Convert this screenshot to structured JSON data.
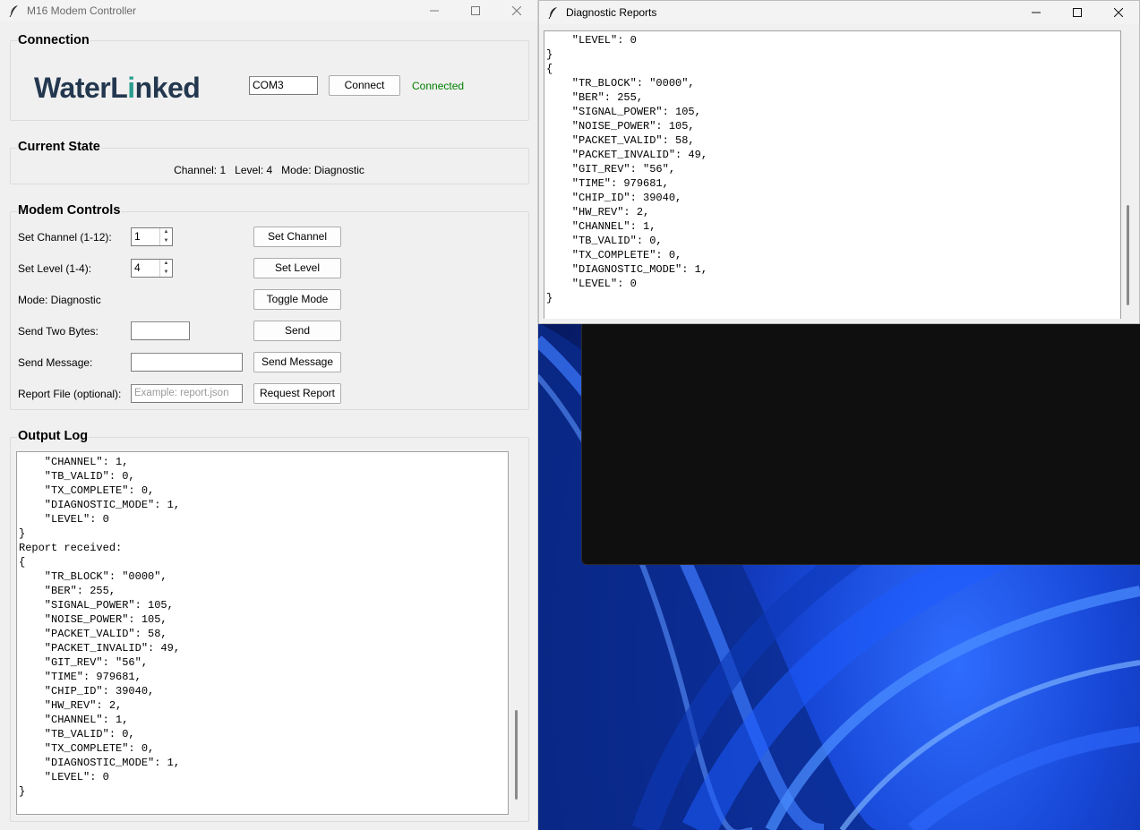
{
  "main_window": {
    "title": "M16 Modem Controller",
    "connection": {
      "section_label": "Connection",
      "logo_pre": "WaterL",
      "logo_dot": "i",
      "logo_post": "nked",
      "port_value": "COM3",
      "connect_label": "Connect",
      "status": "Connected",
      "status_color": "#008000"
    },
    "current_state": {
      "section_label": "Current State",
      "text": "Channel: 1   Level: 4   Mode: Diagnostic"
    },
    "modem_controls": {
      "section_label": "Modem Controls",
      "set_channel_label": "Set Channel (1-12):",
      "channel_value": "1",
      "set_channel_button": "Set Channel",
      "set_level_label": "Set Level (1-4):",
      "level_value": "4",
      "set_level_button": "Set Level",
      "mode_label": "Mode: Diagnostic",
      "toggle_mode_button": "Toggle Mode",
      "send_two_bytes_label": "Send Two Bytes:",
      "two_bytes_value": "",
      "send_button": "Send",
      "send_message_label": "Send Message:",
      "message_value": "",
      "send_message_button": "Send Message",
      "report_file_label": "Report File (optional):",
      "report_file_placeholder": "Example: report.json",
      "request_report_button": "Request Report"
    },
    "output_log": {
      "section_label": "Output Log",
      "lines": [
        "    \"CHANNEL\": 1,",
        "    \"TB_VALID\": 0,",
        "    \"TX_COMPLETE\": 0,",
        "    \"DIAGNOSTIC_MODE\": 1,",
        "    \"LEVEL\": 0",
        "}",
        "Report received:",
        "{",
        "    \"TR_BLOCK\": \"0000\",",
        "    \"BER\": 255,",
        "    \"SIGNAL_POWER\": 105,",
        "    \"NOISE_POWER\": 105,",
        "    \"PACKET_VALID\": 58,",
        "    \"PACKET_INVALID\": 49,",
        "    \"GIT_REV\": \"56\",",
        "    \"TIME\": 979681,",
        "    \"CHIP_ID\": 39040,",
        "    \"HW_REV\": 2,",
        "    \"CHANNEL\": 1,",
        "    \"TB_VALID\": 0,",
        "    \"TX_COMPLETE\": 0,",
        "    \"DIAGNOSTIC_MODE\": 1,",
        "    \"LEVEL\": 0",
        "}"
      ]
    }
  },
  "diag_window": {
    "title": "Diagnostic Reports",
    "lines": [
      "    \"LEVEL\": 0",
      "}",
      "{",
      "    \"TR_BLOCK\": \"0000\",",
      "    \"BER\": 255,",
      "    \"SIGNAL_POWER\": 105,",
      "    \"NOISE_POWER\": 105,",
      "    \"PACKET_VALID\": 58,",
      "    \"PACKET_INVALID\": 49,",
      "    \"GIT_REV\": \"56\",",
      "    \"TIME\": 979681,",
      "    \"CHIP_ID\": 39040,",
      "    \"HW_REV\": 2,",
      "    \"CHANNEL\": 1,",
      "    \"TB_VALID\": 0,",
      "    \"TX_COMPLETE\": 0,",
      "    \"DIAGNOSTIC_MODE\": 1,",
      "    \"LEVEL\": 0",
      "}"
    ]
  },
  "icons": {
    "app": "feather-icon",
    "minimize": "minimize-icon",
    "maximize": "maximize-icon",
    "close": "close-icon"
  }
}
